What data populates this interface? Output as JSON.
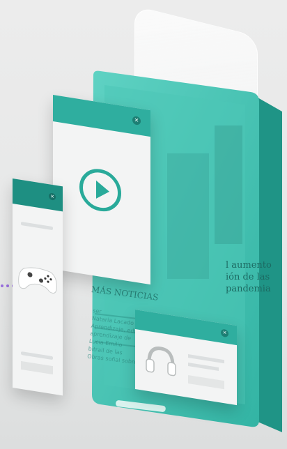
{
  "article": {
    "headline_lines": [
      "l aumento",
      "ión de las",
      "pandemia"
    ],
    "section_title": "MÁS NOTICIAS",
    "body_lines": [
      "ser",
      "Nataria Lacado",
      "Aprendizaje, edu",
      "aprendizaje de",
      "Lucia Emilio",
      "bitrail de las",
      "Obras soñal sobre"
    ]
  },
  "icons": {
    "video_card_action": "play-icon",
    "game_card_icon": "game-controller-icon",
    "audio_card_icon": "headphones-icon",
    "close": "close-icon"
  },
  "colors": {
    "teal": "#2bb3a3",
    "teal_dark": "#1e8f82",
    "card_white": "#f3f4f4",
    "connector": "#9a6fe0"
  }
}
